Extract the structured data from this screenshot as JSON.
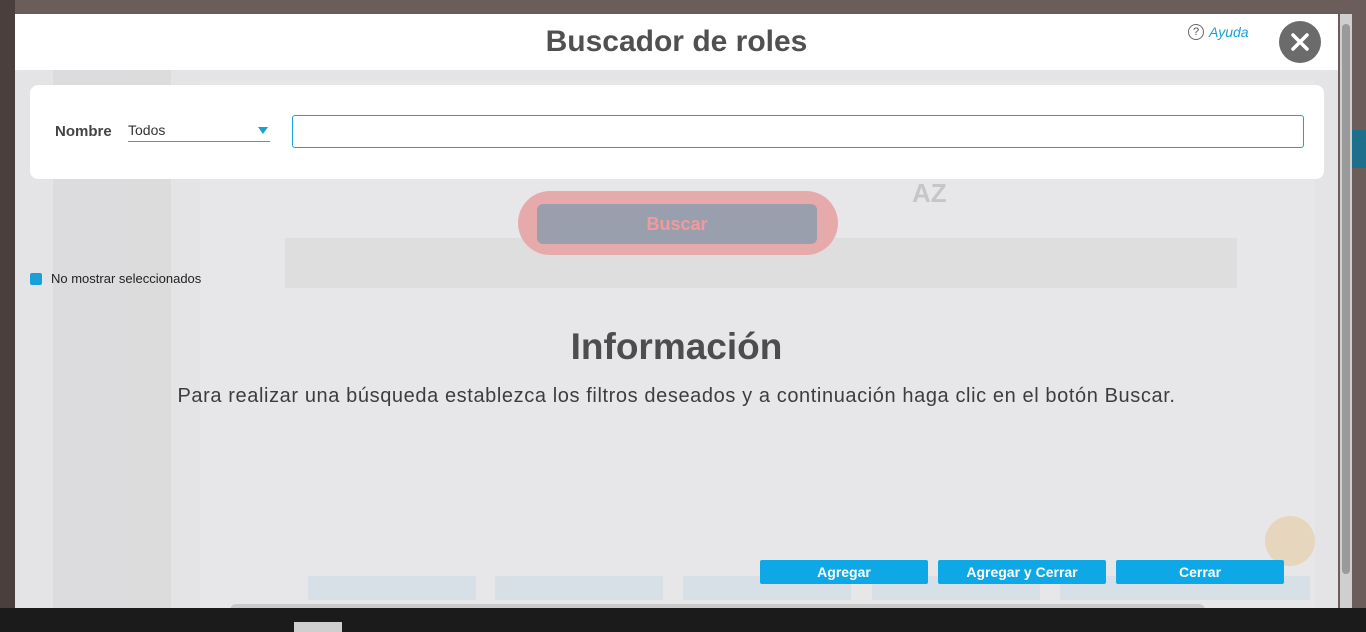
{
  "modal": {
    "title": "Buscador de roles",
    "help_label": "Ayuda",
    "help_icon": "question-circle-icon",
    "close_icon": "close-icon"
  },
  "filter": {
    "label": "Nombre",
    "operator_selected": "Todos",
    "search_value": ""
  },
  "search_button": "Buscar",
  "hide_selected": {
    "label": "No mostrar seleccionados",
    "checked": true
  },
  "info": {
    "title": "Información",
    "message": "Para realizar una búsqueda establezca los filtros deseados y a continuación haga clic en el botón Buscar."
  },
  "footer": {
    "add": "Agregar",
    "add_close": "Agregar y Cerrar",
    "close": "Cerrar"
  },
  "colors": {
    "accent": "#1aa0d8",
    "button_blue": "#0fa8e6",
    "close_button": "#6b6b6b"
  }
}
